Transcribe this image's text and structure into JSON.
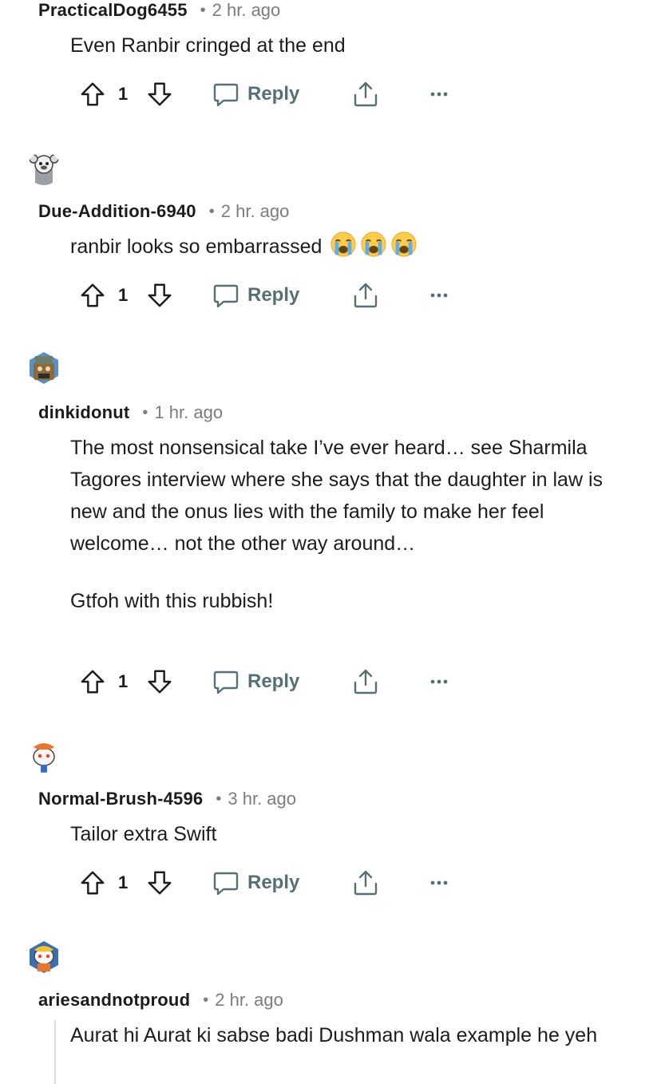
{
  "colors": {
    "meta_gray": "#7c7c7c",
    "action_gray": "#576f76",
    "text": "#1c1c1c"
  },
  "icons": {
    "upvote": "arrow-up-outline-icon",
    "downvote": "arrow-down-outline-icon",
    "reply": "speech-bubble-icon",
    "share": "share-upload-icon",
    "more": "ellipsis-icon"
  },
  "comments": [
    {
      "username": "PracticalDog6455",
      "time": "2 hr. ago",
      "body": [
        "Even Ranbir cringed at the end"
      ],
      "score": "1",
      "reply_label": "Reply"
    },
    {
      "username": "Due-Addition-6940",
      "time": "2 hr. ago",
      "body": [
        "ranbir looks so embarrassed"
      ],
      "emoji": [
        "loudly-crying-face",
        "loudly-crying-face",
        "loudly-crying-face"
      ],
      "score": "1",
      "reply_label": "Reply"
    },
    {
      "username": "dinkidonut",
      "time": "1 hr. ago",
      "body": [
        "The most nonsensical take I’ve ever heard… see Sharmila Tagores interview where she says that the daughter in law is new and the onus lies with the family to make her feel welcome… not the other way around…",
        "Gtfoh with this rubbish!"
      ],
      "score": "1",
      "reply_label": "Reply"
    },
    {
      "username": "Normal-Brush-4596",
      "time": "3 hr. ago",
      "body": [
        "Tailor extra Swift"
      ],
      "score": "1",
      "reply_label": "Reply"
    },
    {
      "username": "ariesandnotproud",
      "time": "2 hr. ago",
      "body": [
        "Aurat hi Aurat ki sabse badi Dushman wala example he yeh"
      ]
    }
  ]
}
